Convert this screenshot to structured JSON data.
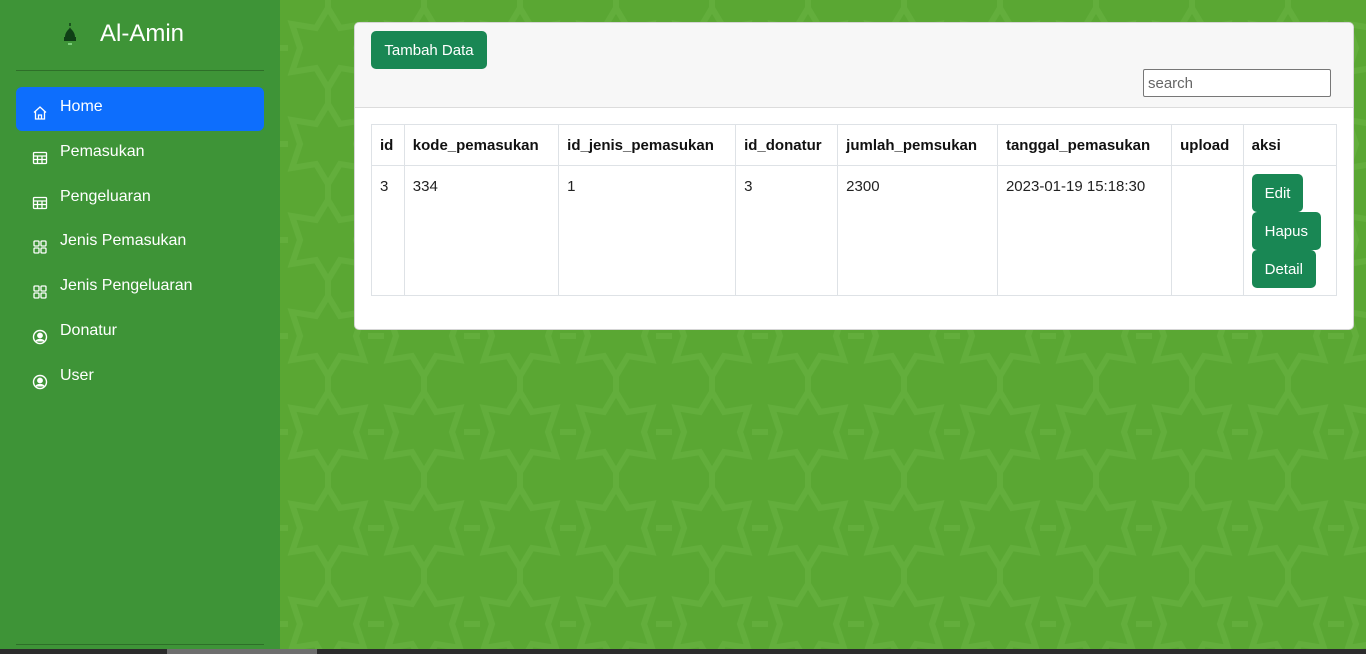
{
  "brand": {
    "name": "Al-Amin"
  },
  "sidebar": {
    "items": [
      {
        "label": "Home",
        "icon": "home-icon",
        "active": true
      },
      {
        "label": "Pemasukan",
        "icon": "table-icon"
      },
      {
        "label": "Pengeluaran",
        "icon": "table-icon"
      },
      {
        "label": "Jenis Pemasukan",
        "icon": "grid-icon"
      },
      {
        "label": "Jenis Pengeluaran",
        "icon": "grid-icon"
      },
      {
        "label": "Donatur",
        "icon": "user-circle-icon"
      },
      {
        "label": "User",
        "icon": "user-circle-icon"
      }
    ]
  },
  "toolbar": {
    "add_label": "Tambah Data",
    "search_placeholder": "search"
  },
  "table": {
    "columns": [
      "id",
      "kode_pemasukan",
      "id_jenis_pemasukan",
      "id_donatur",
      "jumlah_pemsukan",
      "tanggal_pemasukan",
      "upload",
      "aksi"
    ],
    "rows": [
      {
        "id": "3",
        "kode_pemasukan": "334",
        "id_jenis_pemasukan": "1",
        "id_donatur": "3",
        "jumlah_pemsukan": "2300",
        "tanggal_pemasukan": "2023-01-19 15:18:30",
        "upload": ""
      }
    ],
    "actions": {
      "edit": "Edit",
      "delete": "Hapus",
      "detail": "Detail"
    }
  },
  "colors": {
    "background": "#5aa733",
    "sidebar": "#3e9437",
    "active": "#0d6efd",
    "button": "#198754"
  }
}
